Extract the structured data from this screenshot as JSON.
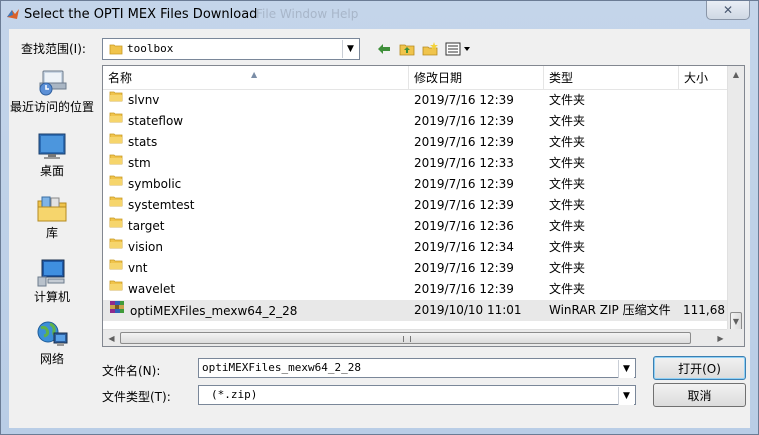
{
  "window": {
    "title": "Select the OPTI MEX Files Download",
    "ghost_menu": "File   Window   Help",
    "close_label": "✕"
  },
  "lookin": {
    "label": "查找范围(I):",
    "value": "toolbox"
  },
  "toolbar": {
    "back_icon": "back-arrow-icon",
    "up_icon": "up-folder-icon",
    "new_folder_icon": "new-folder-icon",
    "view_icon": "view-menu-icon"
  },
  "places": [
    {
      "label": "最近访问的位置",
      "icon": "recent-places-icon"
    },
    {
      "label": "桌面",
      "icon": "desktop-icon"
    },
    {
      "label": "库",
      "icon": "libraries-icon"
    },
    {
      "label": "计算机",
      "icon": "computer-icon"
    },
    {
      "label": "网络",
      "icon": "network-icon"
    }
  ],
  "columns": {
    "name": "名称",
    "date": "修改日期",
    "type": "类型",
    "size": "大小"
  },
  "files": [
    {
      "name": "slvnv",
      "date": "2019/7/16 12:39",
      "type": "文件夹",
      "size": "",
      "kind": "folder"
    },
    {
      "name": "stateflow",
      "date": "2019/7/16 12:39",
      "type": "文件夹",
      "size": "",
      "kind": "folder"
    },
    {
      "name": "stats",
      "date": "2019/7/16 12:39",
      "type": "文件夹",
      "size": "",
      "kind": "folder"
    },
    {
      "name": "stm",
      "date": "2019/7/16 12:33",
      "type": "文件夹",
      "size": "",
      "kind": "folder"
    },
    {
      "name": "symbolic",
      "date": "2019/7/16 12:39",
      "type": "文件夹",
      "size": "",
      "kind": "folder"
    },
    {
      "name": "systemtest",
      "date": "2019/7/16 12:39",
      "type": "文件夹",
      "size": "",
      "kind": "folder"
    },
    {
      "name": "target",
      "date": "2019/7/16 12:36",
      "type": "文件夹",
      "size": "",
      "kind": "folder"
    },
    {
      "name": "vision",
      "date": "2019/7/16 12:34",
      "type": "文件夹",
      "size": "",
      "kind": "folder"
    },
    {
      "name": "vnt",
      "date": "2019/7/16 12:39",
      "type": "文件夹",
      "size": "",
      "kind": "folder"
    },
    {
      "name": "wavelet",
      "date": "2019/7/16 12:39",
      "type": "文件夹",
      "size": "",
      "kind": "folder"
    },
    {
      "name": "optiMEXFiles_mexw64_2_28",
      "date": "2019/10/10 11:01",
      "type": "WinRAR ZIP 压缩文件",
      "size": "111,68",
      "kind": "zip"
    }
  ],
  "filename": {
    "label": "文件名(N):",
    "value": "optiMEXFiles_mexw64_2_28"
  },
  "filetype": {
    "label": "文件类型(T):",
    "value": "(*.zip)"
  },
  "buttons": {
    "open": "打开(O)",
    "cancel": "取消"
  },
  "colors": {
    "selection": "#e8e8e8",
    "folder": "#f0c44c",
    "default_button_border": "#3c7fb1"
  }
}
